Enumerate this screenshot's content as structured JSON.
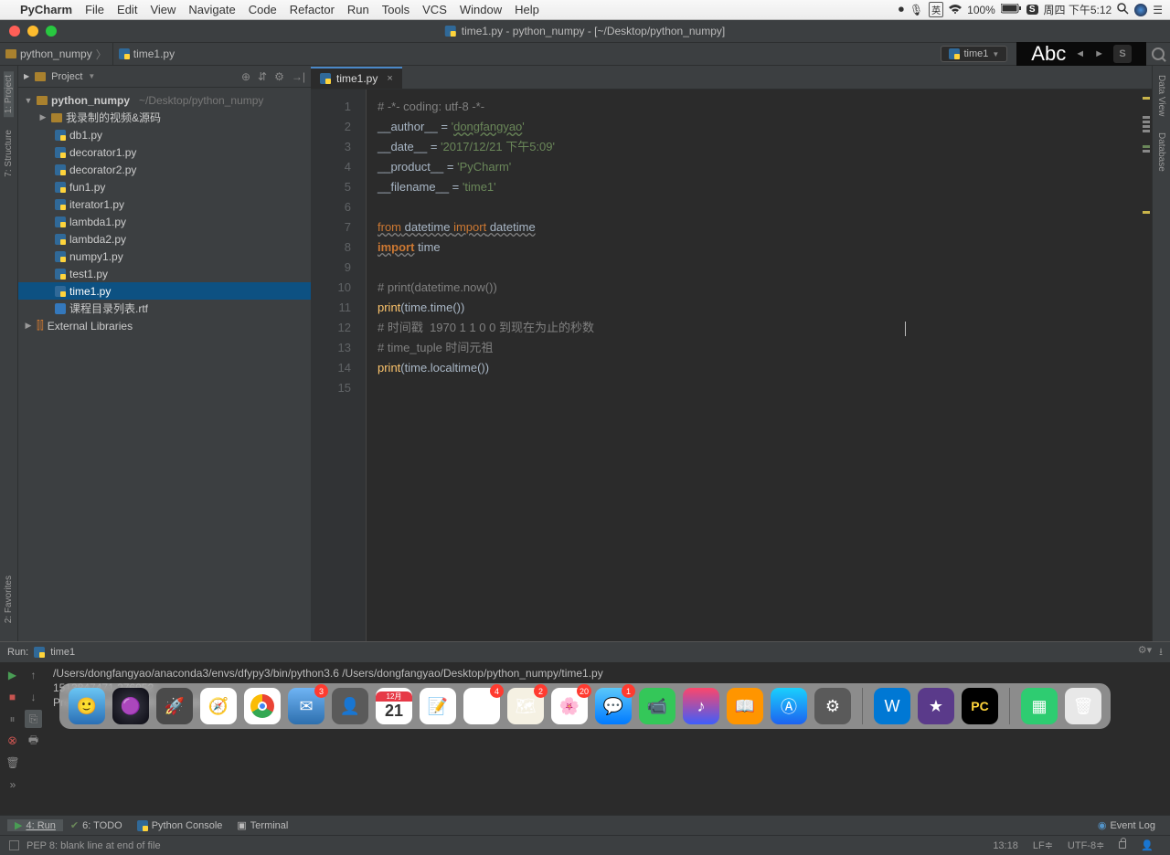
{
  "mac_menu": {
    "app": "PyCharm",
    "items": [
      "File",
      "Edit",
      "View",
      "Navigate",
      "Code",
      "Refactor",
      "Run",
      "Tools",
      "VCS",
      "Window",
      "Help"
    ],
    "battery": "100%",
    "clock": "周四 下午5:12"
  },
  "window": {
    "title": "time1.py - python_numpy - [~/Desktop/python_numpy]"
  },
  "breadcrumb": {
    "root": "python_numpy",
    "file": "time1.py"
  },
  "run_config": {
    "name": "time1"
  },
  "ime_panel": "Abc",
  "sidebar": {
    "gutters": {
      "project": "1: Project",
      "structure": "7: Structure",
      "favorites": "2: Favorites"
    },
    "header": "Project",
    "root": {
      "name": "python_numpy",
      "path": "~/Desktop/python_numpy"
    },
    "folder1": "我录制的视频&源码",
    "files": [
      "db1.py",
      "decorator1.py",
      "decorator2.py",
      "fun1.py",
      "iterator1.py",
      "lambda1.py",
      "lambda2.py",
      "numpy1.py",
      "test1.py",
      "time1.py",
      "课程目录列表.rtf"
    ],
    "selected": "time1.py",
    "ext_lib": "External Libraries"
  },
  "right_gutters": {
    "dataview": "Data View",
    "database": "Database"
  },
  "editor": {
    "tab": "time1.py",
    "lines": {
      "l1": "# -*- coding: utf-8 -*-",
      "l2a": "__author__",
      "l2b": " = ",
      "l2c": "'",
      "l2d": "dongfangyao",
      "l2e": "'",
      "l3a": "__date__",
      "l3b": " = ",
      "l3c": "'2017/12/21 下午5:09'",
      "l4a": "__product__",
      "l4b": " = ",
      "l4c": "'PyCharm'",
      "l5a": "__filename__",
      "l5b": " = ",
      "l5c": "'time1'",
      "l7a": "from",
      "l7b": " datetime ",
      "l7c": "import",
      "l7d": " datetime",
      "l8a": "import",
      "l8b": " time",
      "l10": "# print(datetime.now())",
      "l11a": "print",
      "l11b": "(time.time())",
      "l12": "# 时间戳  1970 1 1 0 0 到现在为止的秒数",
      "l13": "# time_tuple 时间元祖",
      "l14a": "print",
      "l14b": "(time.localtime())"
    },
    "line_nums": [
      "1",
      "2",
      "3",
      "4",
      "5",
      "6",
      "7",
      "8",
      "9",
      "10",
      "11",
      "12",
      "13",
      "14",
      "15"
    ]
  },
  "run": {
    "label": "Run:",
    "config": "time1",
    "out1": "/Users/dongfangyao/anaconda3/envs/dfypy3/bin/python3.6 /Users/dongfangyao/Desktop/python_numpy/time1.py",
    "out2": "1513847471.276052",
    "out3": "",
    "out4": "Process finished with exit code 0"
  },
  "bottom_bar": {
    "run": "4: Run",
    "todo": "6: TODO",
    "console": "Python Console",
    "terminal": "Terminal",
    "eventlog": "Event Log"
  },
  "status": {
    "msg": "PEP 8: blank line at end of file",
    "pos": "13:18",
    "sep": "LF",
    "enc": "UTF-8"
  },
  "dock": {
    "badges": {
      "mail": "3",
      "calendar_date": "21",
      "calendar_month": "12月",
      "reminders": "4",
      "maps": "2",
      "photos": "20",
      "messages": "1"
    }
  }
}
